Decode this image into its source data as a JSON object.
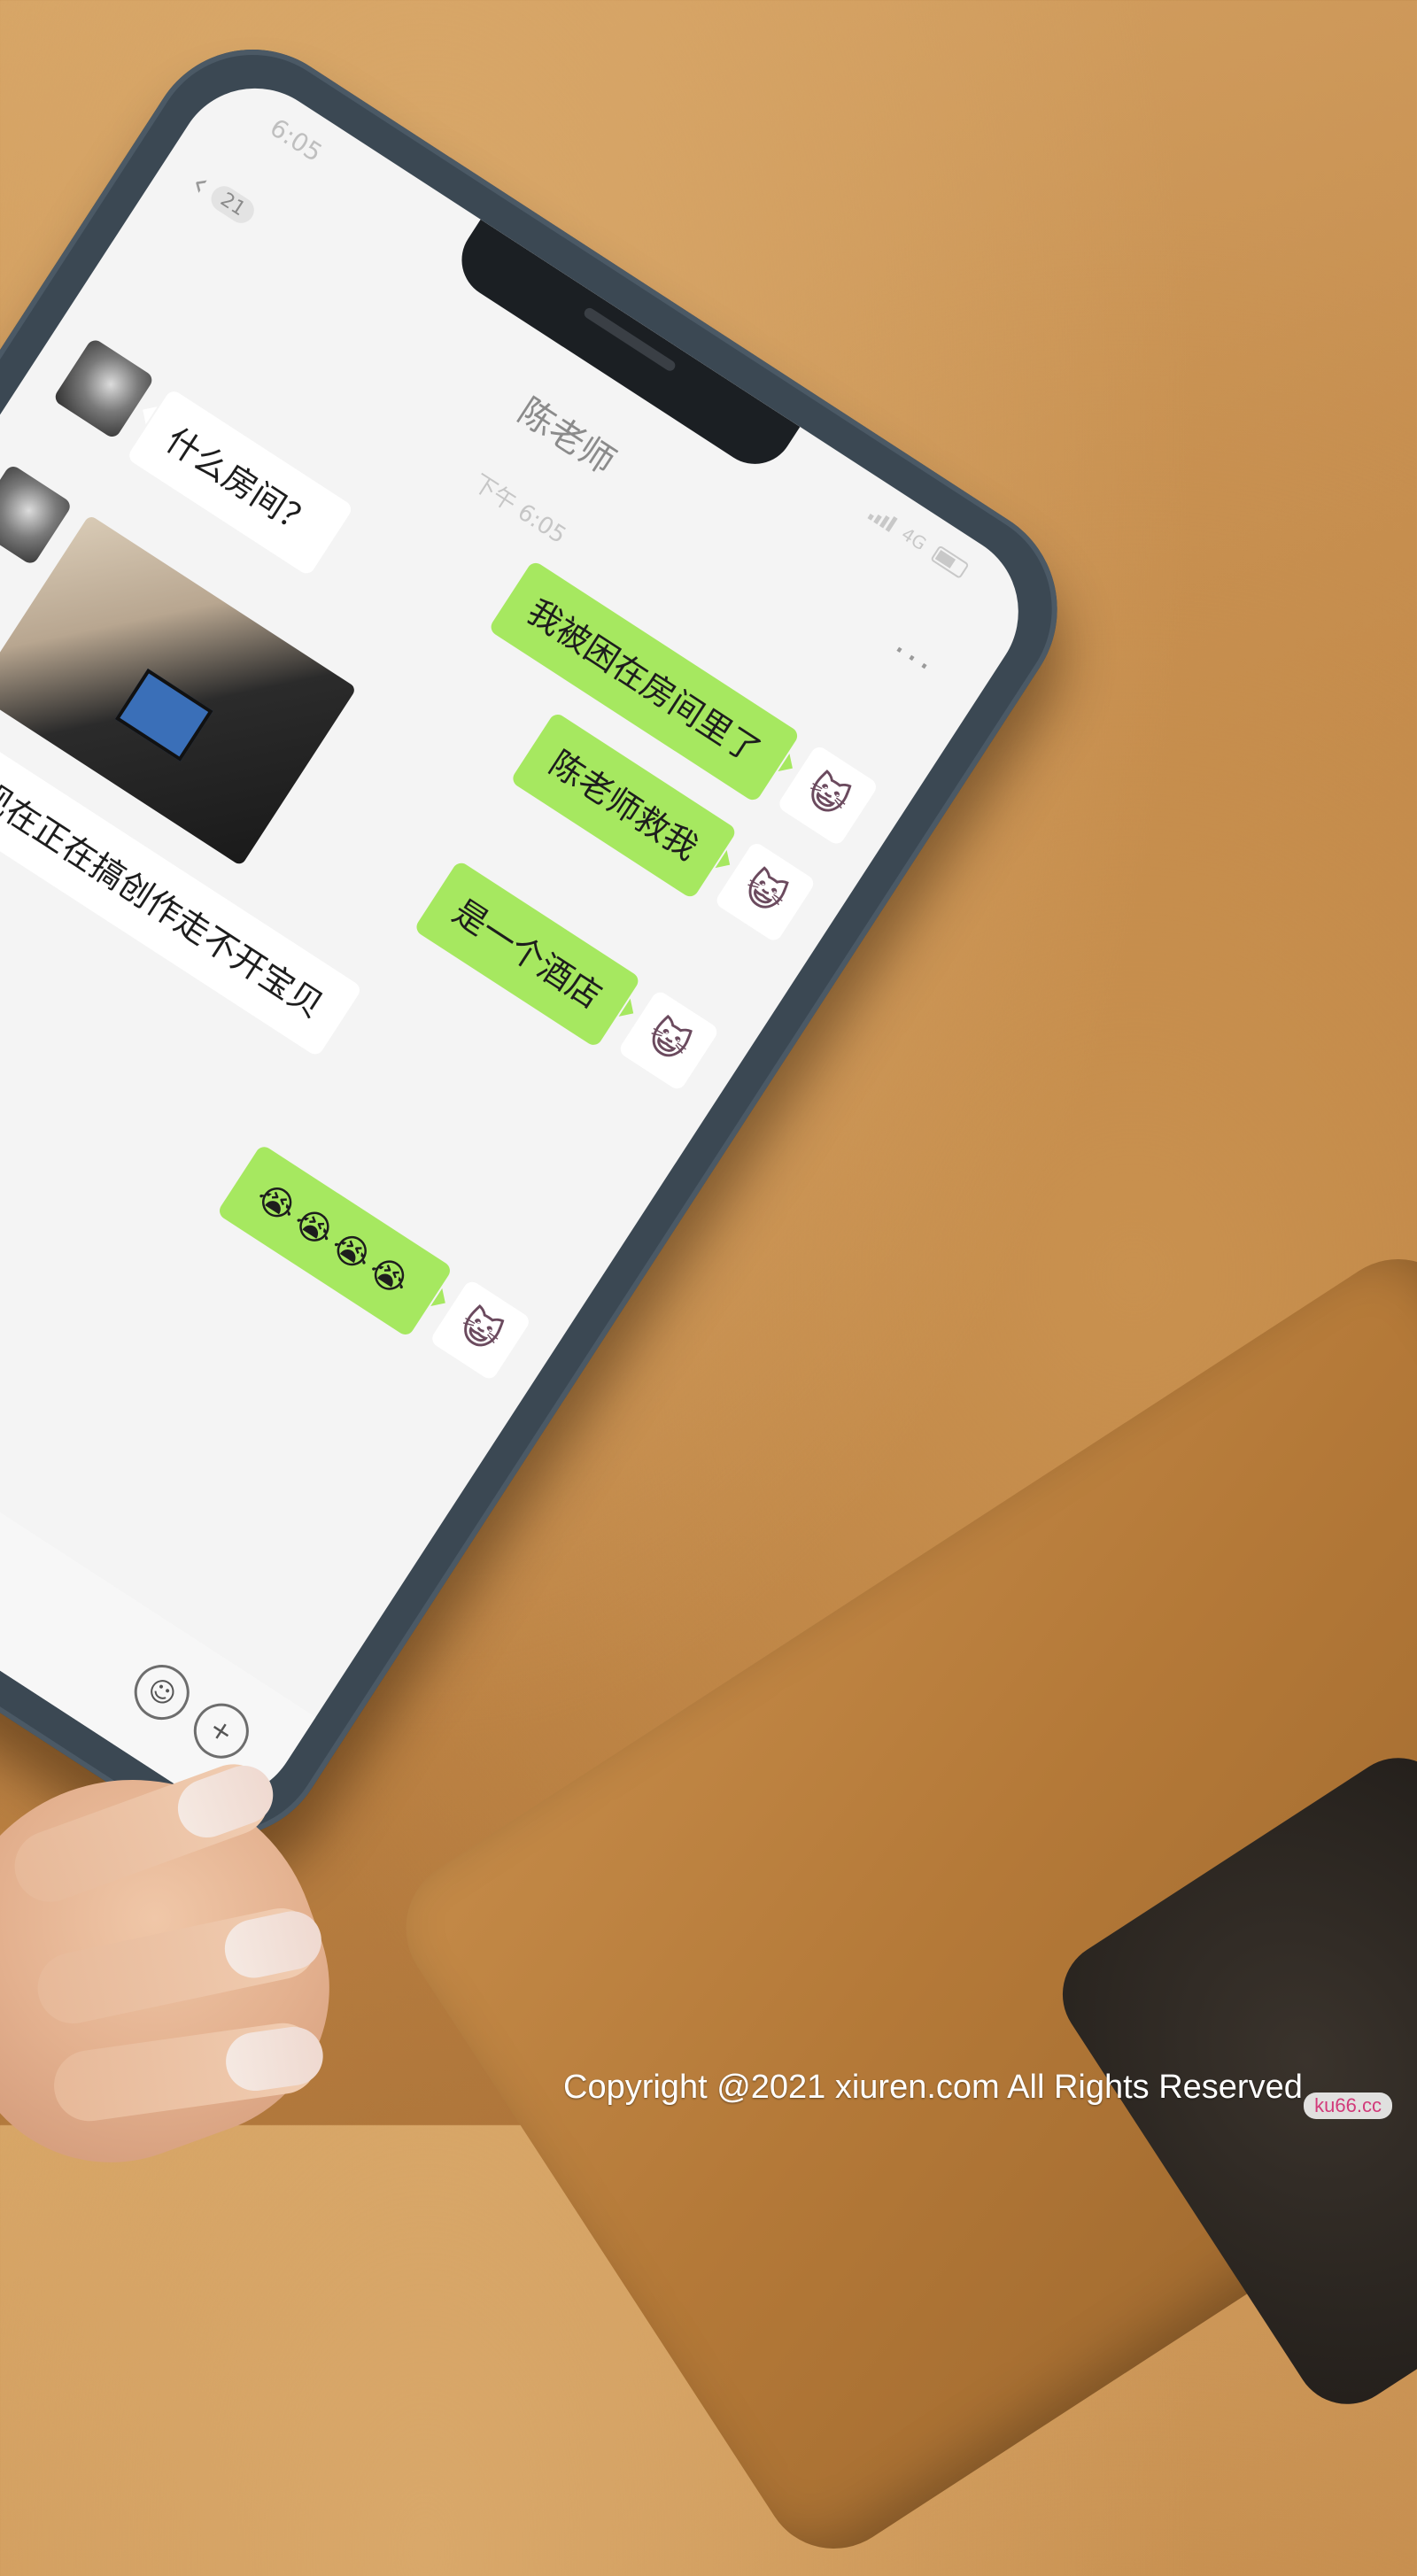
{
  "status_bar": {
    "time": "6:05",
    "network": "4G"
  },
  "nav": {
    "back_glyph": "‹",
    "unread_count": "21",
    "title": "陈老师",
    "more_glyph": "···"
  },
  "timestamp": "下午 6:05",
  "messages": [
    {
      "side": "right",
      "kind": "text",
      "text": "我被困在房间里了"
    },
    {
      "side": "right",
      "kind": "text",
      "text": "陈老师救我"
    },
    {
      "side": "left",
      "kind": "text",
      "text": "什么房间？"
    },
    {
      "side": "right",
      "kind": "text",
      "text": "是一个酒店"
    },
    {
      "side": "left",
      "kind": "image"
    },
    {
      "side": "left",
      "kind": "text",
      "text": "我现在正在搞创作走不开宝贝"
    },
    {
      "side": "right",
      "kind": "text",
      "text": "😭😭😭😭"
    }
  ],
  "input_bar": {
    "voice_icon": "voice-icon",
    "emoji_icon": "emoji-icon",
    "plus_icon": "plus-icon"
  },
  "watermark": {
    "copyright": "Copyright @2021  xiuren.com  All Rights Reserved",
    "badge": "ku66.cc"
  },
  "colors": {
    "bubble_green": "#a6e860",
    "bubble_white": "#ffffff",
    "phone_case": "#3b4853",
    "sofa": "#c38a4b"
  }
}
